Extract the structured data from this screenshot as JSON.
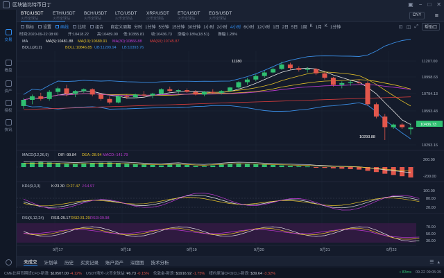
{
  "window": {
    "title": "区块链比特币日丁"
  },
  "sidebar": {
    "items": [
      {
        "label": "交易",
        "active": true
      },
      {
        "label": "看盘"
      },
      {
        "label": "资产"
      },
      {
        "label": "授权"
      },
      {
        "label": "快讯"
      }
    ]
  },
  "tabs": [
    {
      "label": "BTC/USDT",
      "sub": "火币全球站",
      "active": true
    },
    {
      "label": "ETH/USDT",
      "sub": "火币全球站"
    },
    {
      "label": "BCH/USDT",
      "sub": "火币全球站"
    },
    {
      "label": "LTC/USDT",
      "sub": "火币全球站"
    },
    {
      "label": "XRP/USDT",
      "sub": "火币全球站"
    },
    {
      "label": "ETC/USDT",
      "sub": "火币全球站"
    },
    {
      "label": "EOS/USDT",
      "sub": "火币全球站"
    }
  ],
  "currency": "CNY",
  "toolbar": {
    "tools": [
      "指标",
      "设置",
      "画线",
      "比较",
      "组合",
      "自定义周期"
    ],
    "active_tool": "画线",
    "timeframes": [
      "分时",
      "1分钟",
      "5分钟",
      "15分钟",
      "30分钟",
      "1小时",
      "2小时",
      "4小时",
      "6小时",
      "12小时",
      "1日",
      "2日",
      "5日",
      "1周",
      "K",
      "1月",
      "K",
      "1分钟"
    ],
    "active_timeframe": "4小时",
    "help": "帮助口"
  },
  "ohlc": {
    "time_label": "时间:2020-09-22 08:00",
    "open": "开:10418.22",
    "high": "高:10489.00",
    "low": "低:10355.81",
    "close": "收:10436.73",
    "change": "涨幅:0.18%(18.51)",
    "amplitude": "振幅:1.28%"
  },
  "ma": {
    "title": "MA",
    "ma5": "MA(5):10481.88",
    "ma10": "MA(10):10689.91",
    "ma30": "MA(30):10866.88",
    "ma60": "MA(60):10745.87"
  },
  "boll": {
    "title": "BOLL(20,2)",
    "mid": "BOLL:10846.85",
    "ub": "UB:11299.94",
    "lb": "LB:10393.76"
  },
  "macd": {
    "title": "MACD(12,26,9)",
    "dif": "DIF:-99.84",
    "dea": "DEA:-28.94",
    "macd": "MACD:-141.79",
    "values": [
      20,
      22,
      24,
      22,
      20,
      18,
      16,
      18,
      20,
      21,
      22,
      20,
      18,
      15,
      12,
      10,
      8,
      12,
      14,
      10,
      6,
      4,
      8,
      12,
      16,
      18,
      17,
      15,
      12,
      10,
      8,
      6,
      4,
      3,
      -2,
      -4,
      -6,
      -8,
      -10,
      -12,
      -18,
      -24,
      -32,
      -38,
      -44,
      -50
    ]
  },
  "kdj": {
    "title": "KDJ(9,3,3)",
    "k": "K:23.30",
    "d": "D:27.47",
    "j": "J:14.97"
  },
  "rsi": {
    "title": "RSI(6,12,24)",
    "rsi1": "RSI1:25.17",
    "rsi2": "RSI2:31.29",
    "rsi3": "RSI3:39.98"
  },
  "price_axis": [
    "11207.00",
    "10998.63",
    "10794.13",
    "10593.43",
    "10293.16"
  ],
  "macd_axis": [
    "200.00",
    "-200.00"
  ],
  "kdj_axis": [
    "100.00",
    "80.00",
    "20.00"
  ],
  "rsi_axis": [
    "70.00",
    "50.00",
    "30.00"
  ],
  "current_price": "10436.73",
  "high_marker": "11180",
  "low_marker": "10293.88",
  "date_labels": [
    "9月17",
    "9月18",
    "9月19",
    "9月20",
    "9月21",
    "9月22"
  ],
  "chart_data": {
    "type": "candlestick",
    "ylim": [
      10200,
      11300
    ],
    "candles": [
      [
        10680,
        10770,
        10650,
        10750
      ],
      [
        10750,
        10810,
        10700,
        10790
      ],
      [
        10790,
        10830,
        10740,
        10760
      ],
      [
        10760,
        10860,
        10740,
        10840
      ],
      [
        10840,
        10900,
        10800,
        10880
      ],
      [
        10880,
        10920,
        10790,
        10820
      ],
      [
        10820,
        10860,
        10780,
        10850
      ],
      [
        10850,
        10880,
        10830,
        10870
      ],
      [
        10870,
        10880,
        10790,
        10810
      ],
      [
        10810,
        10830,
        10740,
        10760
      ],
      [
        10760,
        10790,
        10700,
        10720
      ],
      [
        10720,
        10800,
        10710,
        10790
      ],
      [
        10790,
        10810,
        10760,
        10780
      ],
      [
        10780,
        10820,
        10770,
        10810
      ],
      [
        10810,
        10850,
        10780,
        10800
      ],
      [
        10800,
        10830,
        10770,
        10820
      ],
      [
        10820,
        10880,
        10810,
        10870
      ],
      [
        10870,
        10900,
        10840,
        10850
      ],
      [
        10850,
        10870,
        10820,
        10860
      ],
      [
        10860,
        10880,
        10830,
        10840
      ],
      [
        10840,
        10860,
        10800,
        10810
      ],
      [
        10810,
        10850,
        10790,
        10840
      ],
      [
        10840,
        10870,
        10820,
        10830
      ],
      [
        10830,
        10860,
        10810,
        10850
      ],
      [
        10850,
        10900,
        10840,
        10890
      ],
      [
        10890,
        10960,
        10880,
        10950
      ],
      [
        10950,
        11000,
        10920,
        10980
      ],
      [
        10980,
        11040,
        10960,
        11020
      ],
      [
        11020,
        11080,
        11000,
        11060
      ],
      [
        11060,
        11120,
        11050,
        11100
      ],
      [
        11100,
        11180,
        11090,
        11150
      ],
      [
        11150,
        11170,
        11090,
        11110
      ],
      [
        11110,
        11130,
        11070,
        11090
      ],
      [
        11090,
        11120,
        11060,
        11100
      ],
      [
        11100,
        11110,
        11030,
        11050
      ],
      [
        11050,
        11070,
        10980,
        11000
      ],
      [
        11000,
        11010,
        10900,
        10920
      ],
      [
        10920,
        10960,
        10880,
        10940
      ],
      [
        10940,
        10970,
        10910,
        10950
      ],
      [
        10950,
        10980,
        10920,
        10940
      ],
      [
        10940,
        10960,
        10680,
        10700
      ],
      [
        10700,
        10720,
        10540,
        10560
      ],
      [
        10560,
        10590,
        10294,
        10440
      ],
      [
        10440,
        10480,
        10420,
        10470
      ],
      [
        10470,
        10490,
        10420,
        10440
      ],
      [
        10418,
        10489,
        10356,
        10437
      ]
    ]
  }
}
